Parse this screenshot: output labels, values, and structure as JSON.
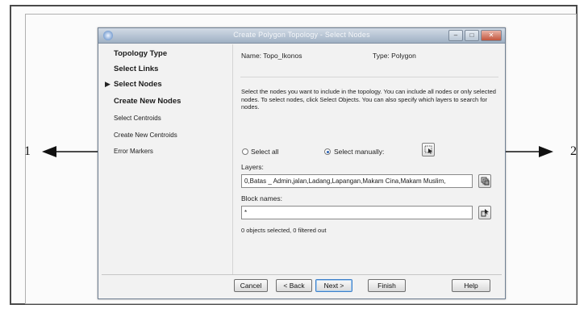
{
  "callouts": {
    "left_number": "1",
    "right_number": "2"
  },
  "dialog": {
    "title": "Create Polygon Topology - Select Nodes",
    "steps": [
      {
        "label": "Topology Type",
        "current": false
      },
      {
        "label": "Select Links",
        "current": false
      },
      {
        "label": "Select Nodes",
        "current": true
      },
      {
        "label": "Create New Nodes",
        "current": false
      },
      {
        "label": "Select Centroids",
        "current": false
      },
      {
        "label": "Create New Centroids",
        "current": false
      },
      {
        "label": "Error Markers",
        "current": false
      }
    ],
    "name_label": "Name: Topo_Ikonos",
    "type_label": "Type: Polygon",
    "description": "Select the nodes you want to include in the topology. You can include all nodes or only selected nodes. To select nodes, click Select Objects. You can also specify which layers to search for nodes.",
    "radio_select_all": "Select all",
    "radio_select_manually": "Select manually:",
    "selected_option": "Select manually:",
    "layers_label": "Layers:",
    "layers_value": "0,Batas _ Admin,jalan,Ladang,Lapangan,Makam Cina,Makam Muslim,",
    "block_names_label": "Block names:",
    "block_names_value": "*",
    "status_text": "0 objects selected, 0 filtered out",
    "buttons": {
      "cancel": "Cancel",
      "back": "< Back",
      "next": "Next >",
      "finish": "Finish",
      "help": "Help"
    }
  }
}
